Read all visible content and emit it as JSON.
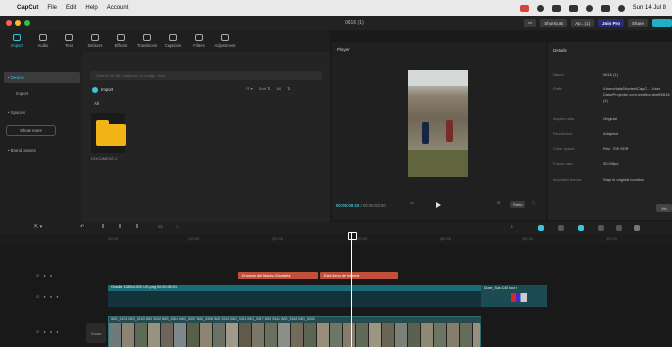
{
  "menubar": {
    "app": "CapCut",
    "items": [
      "File",
      "Edit",
      "Help",
      "Account"
    ],
    "clock": "Sun 14 Jul 8"
  },
  "titlebar": {
    "project_title": "0616 (1)",
    "shortcuts_label": "Shortcuts",
    "user_label": "Ap...(1)",
    "pro_label": "Join Pro",
    "share_label": "Share"
  },
  "tools": [
    {
      "label": "Import",
      "icon": "import-icon",
      "active": true
    },
    {
      "label": "Audio",
      "icon": "audio-icon"
    },
    {
      "label": "Text",
      "icon": "text-icon"
    },
    {
      "label": "Stickers",
      "icon": "stickers-icon"
    },
    {
      "label": "Effects",
      "icon": "effects-icon"
    },
    {
      "label": "Transitions",
      "icon": "transitions-icon"
    },
    {
      "label": "Captions",
      "icon": "captions-icon"
    },
    {
      "label": "Filters",
      "icon": "filters-icon"
    },
    {
      "label": "Adjustment",
      "icon": "adjustment-icon"
    }
  ],
  "sidenav": {
    "device": "• Device",
    "import": "Import",
    "spaces": "• Spaces",
    "show_more": "Show more",
    "brand_assets": "• Brand assets"
  },
  "media": {
    "search_placeholder": "Search for file, subjects, or image, time",
    "import_label": "Import",
    "sort_label": "Sort",
    "all_label": "All",
    "folder_name": "DOCUMENT-2",
    "controls": [
      "Sort ⇅",
      "All",
      "⇅"
    ]
  },
  "player": {
    "title": "Player",
    "time_current": "00:00:00:10",
    "time_total": "00:00:03:00",
    "ratio": "Ratio"
  },
  "details": {
    "title": "Details",
    "rows": [
      {
        "key": "Name:",
        "value": "0616 (1)"
      },
      {
        "key": "Path:",
        "value": "/Users/tala/Movies/CapC... User Data/Projects/ com.lveditor.draft/0616 (1)"
      },
      {
        "key": "Aspect ratio:",
        "value": "Original"
      },
      {
        "key": "Resolution:",
        "value": "Adapted"
      },
      {
        "key": "Color space:",
        "value": "Rec. 709 SDR"
      },
      {
        "key": "Frame rate:",
        "value": "30.00fps"
      },
      {
        "key": "Imported media:",
        "value": "Stay in original location"
      }
    ],
    "modify_label": "Mo"
  },
  "timeline": {
    "ticks": [
      "00:00",
      "|10:00",
      "|20:00",
      "|30:00",
      "|40:00",
      "|50:00",
      "|01:00"
    ],
    "text_clip_1": "Encanto del Machu Montaña",
    "text_clip_2": "Está lleno de historia",
    "video_clip_label": "Gradie 1080x1920 US.png  00:00:45:01",
    "small_clip_label": "Dune_Sub-C40 tool r",
    "main_clip_label": "IMG_9101  IMG_9163  IMG 9202  IMG_9301  IMG_9307  IMG_9308  IMG 9310  IMG_9311  IMG_9317  IMG 9341  IMG_9342  IMG_9343",
    "cover_label": "Cover"
  },
  "colors": {
    "accent": "#38c6d8",
    "text_clip": "#c0503a",
    "video_track": "#1b6c77"
  }
}
